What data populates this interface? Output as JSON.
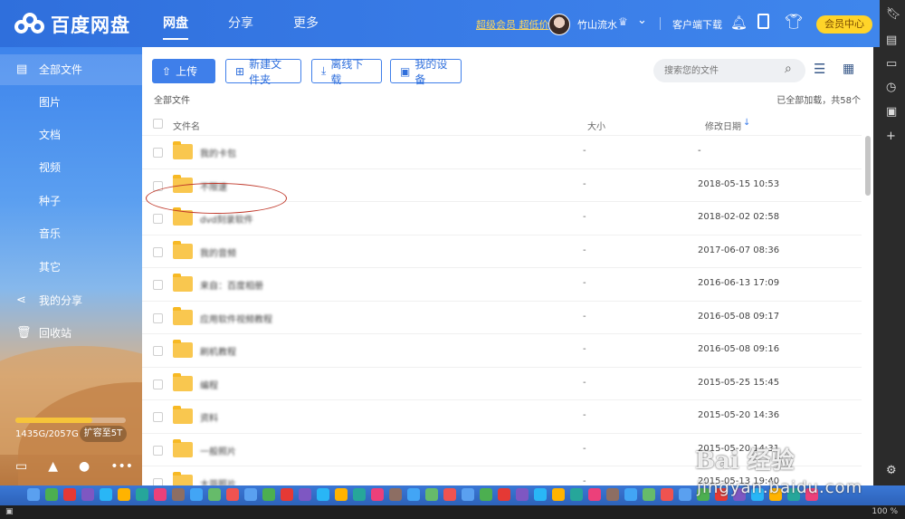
{
  "app": {
    "logo_text": "百度网盘",
    "nav": [
      "网盘",
      "分享",
      "更多"
    ],
    "promo": "超级会员 超低价",
    "username": "竹山流水",
    "client_download": "客户端下载",
    "vip_center": "会员中心"
  },
  "sidebar": {
    "items": [
      {
        "label": "全部文件"
      },
      {
        "label": "图片"
      },
      {
        "label": "文档"
      },
      {
        "label": "视频"
      },
      {
        "label": "种子"
      },
      {
        "label": "音乐"
      },
      {
        "label": "其它"
      },
      {
        "label": "我的分享"
      },
      {
        "label": "回收站"
      }
    ],
    "storage_text": "1435G/2057G",
    "storage_fraction": 0.7,
    "expand_label": "扩容至5T"
  },
  "toolbar": {
    "upload": "上传",
    "new_folder": "新建文件夹",
    "offline": "离线下载",
    "devices": "我的设备",
    "search_placeholder": "搜索您的文件"
  },
  "list": {
    "breadcrumb": "全部文件",
    "loaded_text": "已全部加载，共58个",
    "col_name": "文件名",
    "col_size": "大小",
    "col_date": "修改日期",
    "rows": [
      {
        "name": "我的卡包",
        "size": "-",
        "date": "-"
      },
      {
        "name": "不限速",
        "size": "-",
        "date": "2018-05-15 10:53"
      },
      {
        "name": "dvd刻录软件",
        "size": "-",
        "date": "2018-02-02 02:58"
      },
      {
        "name": "我的音频",
        "size": "-",
        "date": "2017-06-07 08:36"
      },
      {
        "name": "来自：百度相册",
        "size": "-",
        "date": "2016-06-13 17:09"
      },
      {
        "name": "应用软件视频教程",
        "size": "-",
        "date": "2016-05-08 09:17"
      },
      {
        "name": "刷机教程",
        "size": "-",
        "date": "2016-05-08 09:16"
      },
      {
        "name": "编程",
        "size": "-",
        "date": "2015-05-25 15:45"
      },
      {
        "name": "资料",
        "size": "-",
        "date": "2015-05-20 14:36"
      },
      {
        "name": "一般照片",
        "size": "-",
        "date": "2015-05-20 14:31"
      },
      {
        "name": "大哥照片",
        "size": "-",
        "date": "2015-05-13 19:40"
      }
    ]
  },
  "watermark": {
    "big": "Bai 经验",
    "url": "jingyan.baidu.com"
  },
  "statusbar": {
    "zoom": "100 %"
  }
}
